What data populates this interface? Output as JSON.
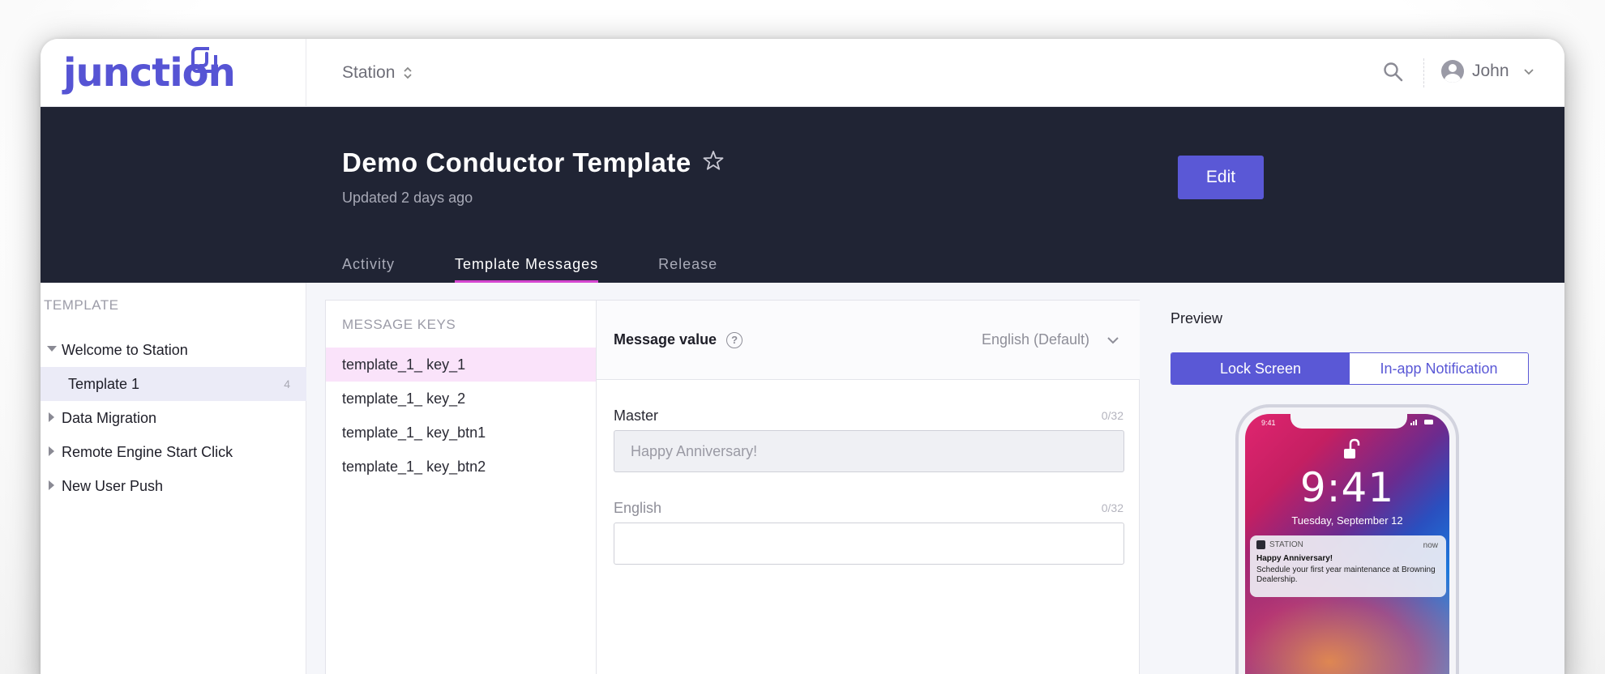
{
  "app": {
    "logo_text": "junction",
    "workspace": "Station",
    "user_name": "John"
  },
  "header": {
    "title": "Demo Conductor Template",
    "updated": "Updated 2 days ago",
    "edit_label": "Edit",
    "tabs": [
      {
        "label": "Activity"
      },
      {
        "label": "Template Messages"
      },
      {
        "label": "Release"
      }
    ]
  },
  "sidebar": {
    "heading": "TEMPLATE",
    "items": [
      {
        "label": "Welcome to Station"
      },
      {
        "label": "Template 1",
        "count": "4"
      },
      {
        "label": "Data Migration"
      },
      {
        "label": "Remote Engine Start Click"
      },
      {
        "label": "New User Push"
      }
    ]
  },
  "keys": {
    "heading": "MESSAGE KEYS",
    "items": [
      {
        "label": "template_1_ key_1"
      },
      {
        "label": "template_1_ key_2"
      },
      {
        "label": "template_1_ key_btn1"
      },
      {
        "label": "template_1_ key_btn2"
      }
    ]
  },
  "value": {
    "title": "Message value",
    "language": "English (Default)",
    "master": {
      "label": "Master",
      "count": "0/32",
      "value": "Happy Anniversary!"
    },
    "english": {
      "label": "English",
      "count": "0/32",
      "value": ""
    }
  },
  "preview": {
    "title": "Preview",
    "segments": [
      "Lock Screen",
      "In-app Notification"
    ],
    "phone": {
      "status_time": "9:41",
      "clock": "9:41",
      "date": "Tuesday, September 12",
      "notif_app": "STATION",
      "notif_time": "now",
      "notif_title": "Happy Anniversary!",
      "notif_body": "Schedule your first year maintenance at Browning Dealership."
    }
  },
  "colors": {
    "accent": "#5a58d6",
    "header_bg": "#202434",
    "tab_underline": "#d546d0",
    "selected_key_bg": "#fae3fa"
  }
}
